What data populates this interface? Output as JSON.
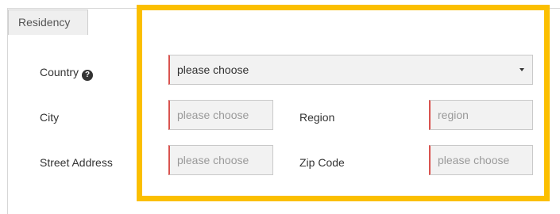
{
  "tab": {
    "label": "Residency"
  },
  "form": {
    "country": {
      "label": "Country",
      "value": "please choose"
    },
    "city": {
      "label": "City",
      "placeholder": "please choose"
    },
    "region": {
      "label": "Region",
      "placeholder": "region"
    },
    "street": {
      "label": "Street Address",
      "placeholder": "please choose"
    },
    "zip": {
      "label": "Zip Code",
      "placeholder": "please choose"
    }
  },
  "colors": {
    "highlight": "#fbbf00",
    "required_marker": "#d9534f",
    "field_background": "#f2f2f2"
  }
}
